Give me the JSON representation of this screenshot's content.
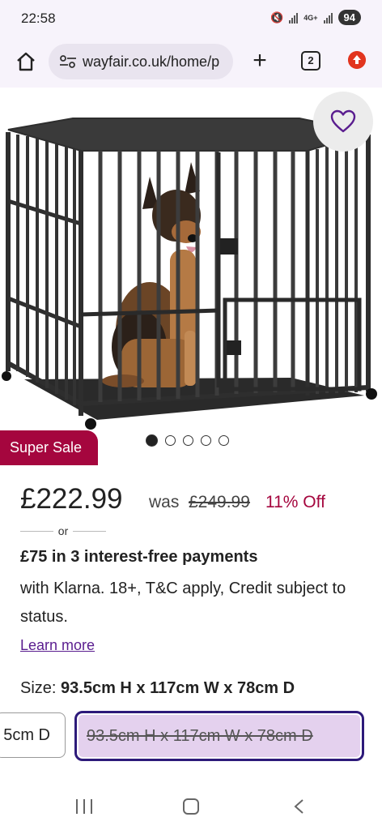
{
  "status": {
    "time": "22:58",
    "network": "4G+",
    "battery": "94"
  },
  "browser": {
    "url": "wayfair.co.uk/home/p",
    "tab_count": "2"
  },
  "hero": {
    "badge": "Super Sale",
    "carousel_total": 5,
    "carousel_active": 1
  },
  "price": {
    "current": "£222.99",
    "was_label": "was",
    "was_price": "£249.99",
    "discount": "11% Off"
  },
  "financing": {
    "or_label": "or",
    "headline": "£75 in 3 interest-free payments",
    "detail": "with Klarna. 18+, T&C apply, Credit subject to status.",
    "learn_more": "Learn more"
  },
  "size": {
    "label": "Size:",
    "selected": "93.5cm H x 117cm W x 78cm D",
    "options": [
      {
        "label": "5cm D",
        "state": "available"
      },
      {
        "label": "93.5cm H x 117cm W x 78cm D",
        "state": "selected-unavailable"
      }
    ]
  },
  "colors": {
    "brand": "#a5063e",
    "link": "#5a1d8f",
    "selected_border": "#2d1a7a",
    "selected_fill": "#e4d1ee"
  }
}
